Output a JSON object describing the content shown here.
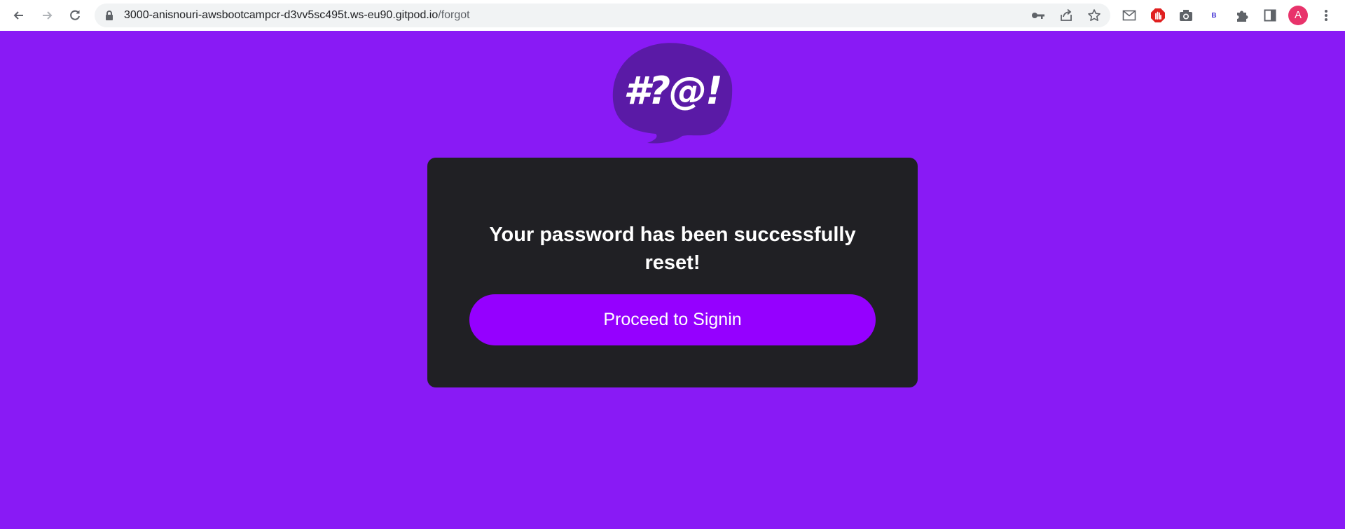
{
  "browser": {
    "url_host": "3000-anisnouri-awsbootcampcr-d3vv5sc495t.ws-eu90.gitpod.io",
    "url_path": "/forgot",
    "avatar_letter": "A",
    "nav_icons": [
      "back-arrow-icon",
      "forward-arrow-icon",
      "reload-icon"
    ],
    "omnibox_icons": [
      "lock-icon",
      "key-icon",
      "share-icon",
      "star-icon"
    ],
    "extension_icons": [
      "mail-icon",
      "stop-hand-icon",
      "camera-icon",
      "b-extension-icon",
      "puzzle-icon",
      "sidebar-icon",
      "menu-dots-icon"
    ],
    "extension_b_label": "B"
  },
  "logo": {
    "text": "#?@!",
    "bubble_color": "#5a1aa6"
  },
  "card": {
    "title": "Your password has been successfully reset!",
    "button_label": "Proceed to Signin"
  },
  "colors": {
    "page_background": "#891af5",
    "card_background": "#202024",
    "button_background": "#9500ff",
    "avatar_background": "#e8336b"
  }
}
